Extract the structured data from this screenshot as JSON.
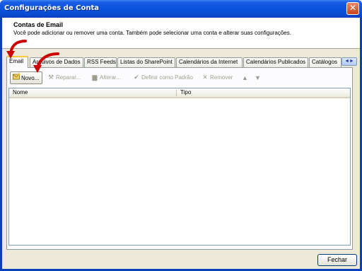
{
  "window": {
    "title": "Configurações de Conta",
    "close_glyph": "✕"
  },
  "header": {
    "title": "Contas de Email",
    "description": "Você pode adicionar ou remover uma conta. Também pode selecionar uma conta e alterar suas configurações."
  },
  "tabs": [
    {
      "label": "Email",
      "active": true
    },
    {
      "label": "Arquivos de Dados"
    },
    {
      "label": "RSS Feeds"
    },
    {
      "label": "Listas do SharePoint"
    },
    {
      "label": "Calendários da Internet"
    },
    {
      "label": "Calendários Publicados"
    },
    {
      "label": "Catálogos"
    }
  ],
  "tab_scroll": {
    "left": "◄",
    "right": "►"
  },
  "toolbar": {
    "new": {
      "label": "Novo...",
      "icon": "new-account-icon"
    },
    "repair": {
      "label": "Reparar...",
      "icon": "repair-icon"
    },
    "change": {
      "label": "Alterar...",
      "icon": "change-icon"
    },
    "set_default": {
      "label": "Definir como Padrão",
      "icon": "check-circle-icon"
    },
    "remove": {
      "label": "Remover",
      "icon": "remove-x-icon"
    },
    "move_up": "▲",
    "move_down": "▼"
  },
  "list": {
    "columns": [
      "Nome",
      "Tipo"
    ],
    "rows": []
  },
  "footer": {
    "close_label": "Fechar"
  },
  "colors": {
    "title_bar": "#0a4bd3",
    "face": "#ece9d8",
    "annotation_arrow": "#cc0000",
    "active_tab_accent": "#ffc83c"
  }
}
